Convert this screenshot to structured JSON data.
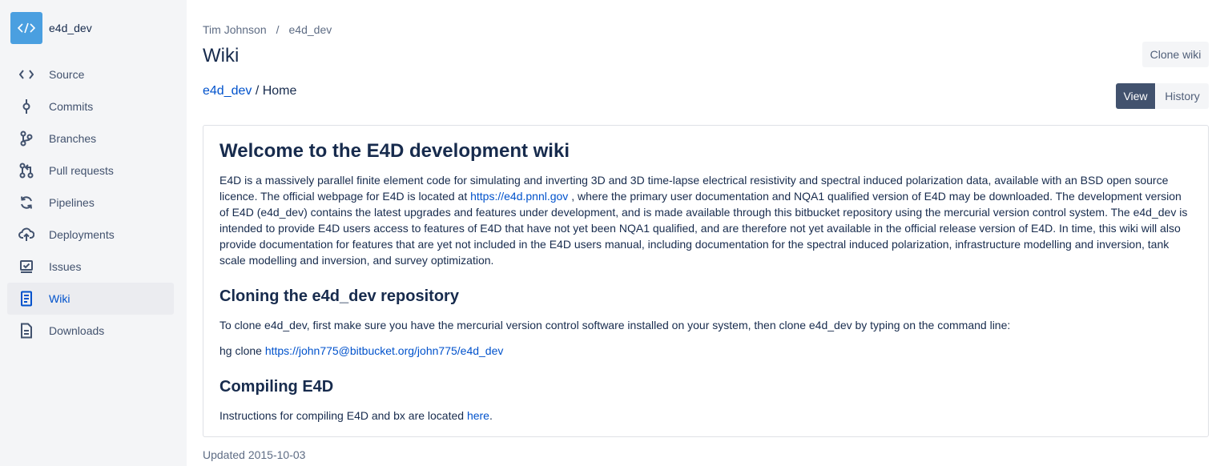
{
  "repo": {
    "name": "e4d_dev",
    "avatar_icon": "code-icon",
    "avatar_color": "#4a9fe0"
  },
  "sidebar": {
    "items": [
      {
        "label": "Source",
        "icon": "code-icon"
      },
      {
        "label": "Commits",
        "icon": "commit-icon"
      },
      {
        "label": "Branches",
        "icon": "branch-icon"
      },
      {
        "label": "Pull requests",
        "icon": "pull-request-icon"
      },
      {
        "label": "Pipelines",
        "icon": "pipelines-icon"
      },
      {
        "label": "Deployments",
        "icon": "cloud-upload-icon"
      },
      {
        "label": "Issues",
        "icon": "issues-icon"
      },
      {
        "label": "Wiki",
        "icon": "wiki-icon",
        "active": true
      },
      {
        "label": "Downloads",
        "icon": "file-icon"
      }
    ]
  },
  "header": {
    "breadcrumb": [
      "Tim Johnson",
      "/",
      "e4d_dev"
    ],
    "title": "Wiki",
    "clone_label": "Clone wiki",
    "view_label": "View",
    "history_label": "History"
  },
  "wiki_path": {
    "repo_link": "e4d_dev",
    "page": " / Home"
  },
  "content": {
    "h1": "Welcome to the E4D development wiki",
    "intro_a": "E4D is a massively parallel finite element code for simulating and inverting 3D and 3D time-lapse electrical resistivity and spectral induced polarization data, available with an BSD open source licence. The official webpage for E4D is located at ",
    "intro_link": "https://e4d.pnnl.gov",
    "intro_b": " , where the primary user documentation and NQA1 qualified version of E4D may be downloaded. The development version of E4D (e4d_dev) contains the latest upgrades and features under development, and is made available through this bitbucket repository using the mercurial version control system. The e4d_dev is intended to provide E4D users access to features of E4D that have not yet been NQA1 qualified, and are therefore not yet available in the official release version of E4D. In time, this wiki will also provide documentation for features that are yet not included in the E4D users manual, including documentation for the spectral induced polarization, infrastructure modelling and inversion, tank scale modelling and inversion, and survey optimization.",
    "h2_clone": "Cloning the e4d_dev repository",
    "clone_text": "To clone e4d_dev, first make sure you have the mercurial version control software installed on your system, then clone e4d_dev by typing on the command line:",
    "clone_cmd": "hg clone ",
    "clone_link": "https://john775@bitbucket.org/john775/e4d_dev",
    "h2_compile": "Compiling E4D",
    "compile_text": "Instructions for compiling E4D and bx are located ",
    "compile_link": "here",
    "compile_end": "."
  },
  "footer": {
    "updated": "Updated 2015-10-03"
  },
  "colors": {
    "accent": "#0052cc",
    "sidebar_bg": "#f4f5f7",
    "primary_button": "#42526e"
  }
}
